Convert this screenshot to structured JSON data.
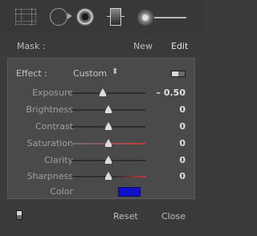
{
  "toolbar": {
    "tools": [
      "crop-overlay-icon",
      "spot-removal-icon",
      "red-eye-icon",
      "graduated-filter-icon",
      "adjustment-brush-icon"
    ]
  },
  "mask": {
    "label": "Mask :",
    "new_label": "New",
    "edit_label": "Edit"
  },
  "effect": {
    "label": "Effect :",
    "value": "Custom",
    "updown_glyph": "⬍"
  },
  "sliders": [
    {
      "label": "Exposure",
      "value": "– 0.50",
      "position": 0.42
    },
    {
      "label": "Brightness",
      "value": "0",
      "position": 0.5
    },
    {
      "label": "Contrast",
      "value": "0",
      "position": 0.5
    },
    {
      "label": "Saturation",
      "value": "0",
      "position": 0.5
    },
    {
      "label": "Clarity",
      "value": "0",
      "position": 0.5
    },
    {
      "label": "Sharpness",
      "value": "0",
      "position": 0.5
    }
  ],
  "color": {
    "label": "Color",
    "swatch": "#1010c8"
  },
  "footer": {
    "reset_label": "Reset",
    "close_label": "Close"
  }
}
